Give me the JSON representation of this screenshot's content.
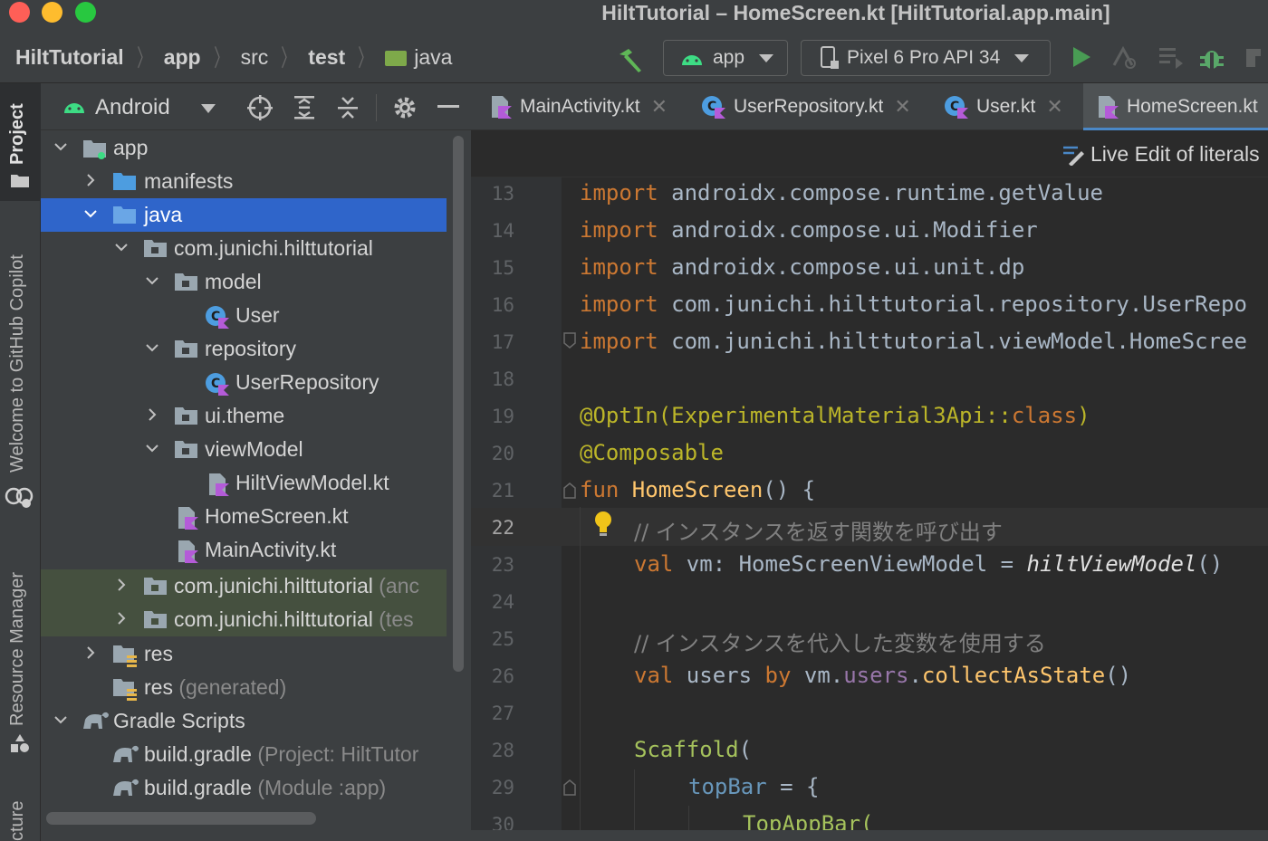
{
  "window": {
    "title": "HiltTutorial – HomeScreen.kt [HiltTutorial.app.main]",
    "traffic_colors": [
      "#fe5f57",
      "#febc2e",
      "#28c840"
    ]
  },
  "navbar": {
    "breadcrumb": [
      "HiltTutorial",
      "app",
      "src",
      "test",
      "java"
    ],
    "run_config": "app",
    "device": "Pixel 6 Pro API 34"
  },
  "stripe": {
    "project": "Project",
    "copilot": "Welcome to GitHub Copilot",
    "resource_manager": "Resource Manager",
    "structure": "cture"
  },
  "project": {
    "view_mode": "Android",
    "tree": [
      {
        "label": "app",
        "suffix": ""
      },
      {
        "label": "manifests",
        "suffix": ""
      },
      {
        "label": "java",
        "suffix": ""
      },
      {
        "label": "com.junichi.hilttutorial",
        "suffix": ""
      },
      {
        "label": "model",
        "suffix": ""
      },
      {
        "label": "User",
        "suffix": ""
      },
      {
        "label": "repository",
        "suffix": ""
      },
      {
        "label": "UserRepository",
        "suffix": ""
      },
      {
        "label": "ui.theme",
        "suffix": ""
      },
      {
        "label": "viewModel",
        "suffix": ""
      },
      {
        "label": "HiltViewModel.kt",
        "suffix": ""
      },
      {
        "label": "HomeScreen.kt",
        "suffix": ""
      },
      {
        "label": "MainActivity.kt",
        "suffix": ""
      },
      {
        "label": "com.junichi.hilttutorial",
        "suffix": "(anc"
      },
      {
        "label": "com.junichi.hilttutorial",
        "suffix": "(tes"
      },
      {
        "label": "res",
        "suffix": ""
      },
      {
        "label": "res",
        "suffix": "(generated)"
      },
      {
        "label": "Gradle Scripts",
        "suffix": ""
      },
      {
        "label": "build.gradle",
        "suffix": "(Project: HiltTutor"
      },
      {
        "label": "build.gradle",
        "suffix": "(Module :app)"
      }
    ]
  },
  "editor": {
    "tabs": [
      "MainActivity.kt",
      "UserRepository.kt",
      "User.kt",
      "HomeScreen.kt"
    ],
    "active_tab": "HomeScreen.kt",
    "live_edit": "Live Edit of literals",
    "current_line": "22",
    "line_numbers": [
      "13",
      "14",
      "15",
      "16",
      "17",
      "18",
      "19",
      "20",
      "21",
      "22",
      "23",
      "24",
      "25",
      "26",
      "27",
      "28",
      "29",
      "30"
    ],
    "code": {
      "l13_kw": "import",
      "l13": " androidx.compose.runtime.getValue",
      "l14_kw": "import",
      "l14": " androidx.compose.ui.Modifier",
      "l15_kw": "import",
      "l15": " androidx.compose.ui.unit.dp",
      "l16_kw": "import",
      "l16": " com.junichi.hilttutorial.repository.UserRepo",
      "l17_kw": "import",
      "l17": " com.junichi.hilttutorial.viewModel.HomeScree",
      "l19_ann": "@OptIn(ExperimentalMaterial3Api::",
      "l19_kw": "class",
      "l19_end": ")",
      "l20_ann": "@Composable",
      "l21_kw": "fun ",
      "l21_fn": "HomeScreen",
      "l21_end": "() {",
      "l22_cm": "// インスタンスを返す関数を呼び出す",
      "l23_kw": "val",
      "l23_a": " vm: HomeScreenViewModel = ",
      "l23_it": "hiltViewModel",
      "l23_end": "()",
      "l25_cm": "// インスタンスを代入した変数を使用する",
      "l26_kw": "val",
      "l26_a": " users ",
      "l26_by": "by",
      "l26_b": " vm.",
      "l26_prop": "users",
      "l26_c": ".",
      "l26_call": "collectAsState",
      "l26_end": "()",
      "l28_call": "Scaffold",
      "l28_end": "(",
      "l29_prop": "topBar",
      "l29_end": " = {",
      "l30": "TopAppBar("
    }
  }
}
